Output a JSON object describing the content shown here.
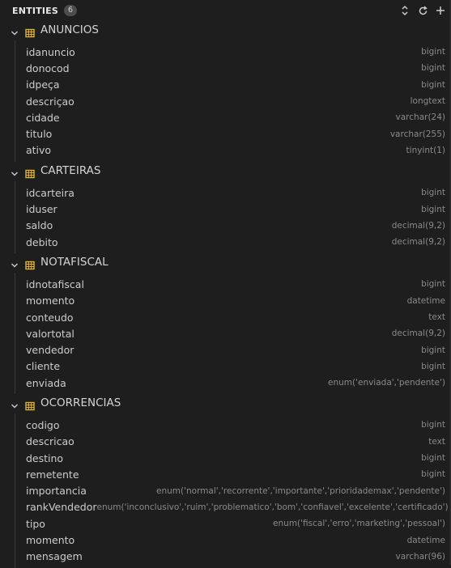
{
  "header": {
    "title": "ENTITIES",
    "count": "6"
  },
  "icons": {
    "collapse": "collapse-all-icon",
    "refresh": "refresh-icon",
    "add": "add-icon",
    "chevron": "chevron-down-icon",
    "table": "table-icon"
  },
  "colors": {
    "table_icon": "#e0b030",
    "background": "#1e1e1e",
    "type_text": "#8a8a8a"
  },
  "entities": [
    {
      "name": "ANUNCIOS",
      "fields": [
        {
          "name": "idanuncio",
          "type": "bigint"
        },
        {
          "name": "donocod",
          "type": "bigint"
        },
        {
          "name": "idpeça",
          "type": "bigint"
        },
        {
          "name": "descriçao",
          "type": "longtext"
        },
        {
          "name": "cidade",
          "type": "varchar(24)"
        },
        {
          "name": "titulo",
          "type": "varchar(255)"
        },
        {
          "name": "ativo",
          "type": "tinyint(1)"
        }
      ]
    },
    {
      "name": "CARTEIRAS",
      "fields": [
        {
          "name": "idcarteira",
          "type": "bigint"
        },
        {
          "name": "iduser",
          "type": "bigint"
        },
        {
          "name": "saldo",
          "type": "decimal(9,2)"
        },
        {
          "name": "debito",
          "type": "decimal(9,2)"
        }
      ]
    },
    {
      "name": "NOTAFISCAL",
      "fields": [
        {
          "name": "idnotafiscal",
          "type": "bigint"
        },
        {
          "name": "momento",
          "type": "datetime"
        },
        {
          "name": "conteudo",
          "type": "text"
        },
        {
          "name": "valortotal",
          "type": "decimal(9,2)"
        },
        {
          "name": "vendedor",
          "type": "bigint"
        },
        {
          "name": "cliente",
          "type": "bigint"
        },
        {
          "name": "enviada",
          "type": "enum('enviada','pendente')"
        }
      ]
    },
    {
      "name": "OCORRENCIAS",
      "fields": [
        {
          "name": "codigo",
          "type": "bigint"
        },
        {
          "name": "descricao",
          "type": "text"
        },
        {
          "name": "destino",
          "type": "bigint"
        },
        {
          "name": "remetente",
          "type": "bigint"
        },
        {
          "name": "importancia",
          "type": "enum('normal','recorrente','importante','prioridademax','pendente')"
        },
        {
          "name": "rankVendedor",
          "type": "enum('inconclusivo','ruim','problematico','bom','confiavel','excelente','certificado')"
        },
        {
          "name": "tipo",
          "type": "enum('fiscal','erro','marketing','pessoal')"
        },
        {
          "name": "momento",
          "type": "datetime"
        },
        {
          "name": "mensagem",
          "type": "varchar(96)"
        }
      ]
    }
  ]
}
